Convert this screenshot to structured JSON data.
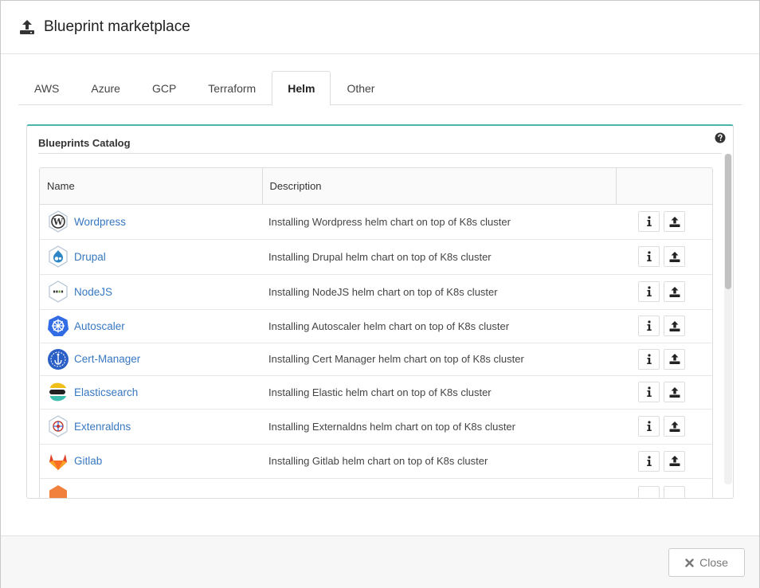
{
  "modal": {
    "title": "Blueprint marketplace"
  },
  "tabs": [
    {
      "label": "AWS",
      "active": false
    },
    {
      "label": "Azure",
      "active": false
    },
    {
      "label": "GCP",
      "active": false
    },
    {
      "label": "Terraform",
      "active": false
    },
    {
      "label": "Helm",
      "active": true
    },
    {
      "label": "Other",
      "active": false
    }
  ],
  "catalog": {
    "title": "Blueprints Catalog",
    "help_icon": "question-circle-icon",
    "columns": {
      "name": "Name",
      "description": "Description",
      "actions": ""
    },
    "rows": [
      {
        "name": "Wordpress",
        "description": "Installing Wordpress helm chart on top of K8s cluster",
        "icon": "wordpress-icon"
      },
      {
        "name": "Drupal",
        "description": "Installing Drupal helm chart on top of K8s cluster",
        "icon": "drupal-icon"
      },
      {
        "name": "NodeJS",
        "description": "Installing NodeJS helm chart on top of K8s cluster",
        "icon": "nodejs-icon"
      },
      {
        "name": "Autoscaler",
        "description": "Installing Autoscaler helm chart on top of K8s cluster",
        "icon": "kubernetes-icon"
      },
      {
        "name": "Cert-Manager",
        "description": "Installing Cert Manager helm chart on top of K8s cluster",
        "icon": "cert-manager-icon"
      },
      {
        "name": "Elasticsearch",
        "description": "Installing Elastic helm chart on top of K8s cluster",
        "icon": "elasticsearch-icon"
      },
      {
        "name": "Extenraldns",
        "description": "Installing Externaldns helm chart on top of K8s cluster",
        "icon": "externaldns-icon"
      },
      {
        "name": "Gitlab",
        "description": "Installing Gitlab helm chart on top of K8s cluster",
        "icon": "gitlab-icon"
      }
    ],
    "row_actions": {
      "info": "info-icon",
      "upload": "upload-icon"
    }
  },
  "footer": {
    "close_label": "Close",
    "close_icon": "close-icon"
  },
  "colors": {
    "accent": "#4db6ac",
    "link": "#3778c2"
  }
}
